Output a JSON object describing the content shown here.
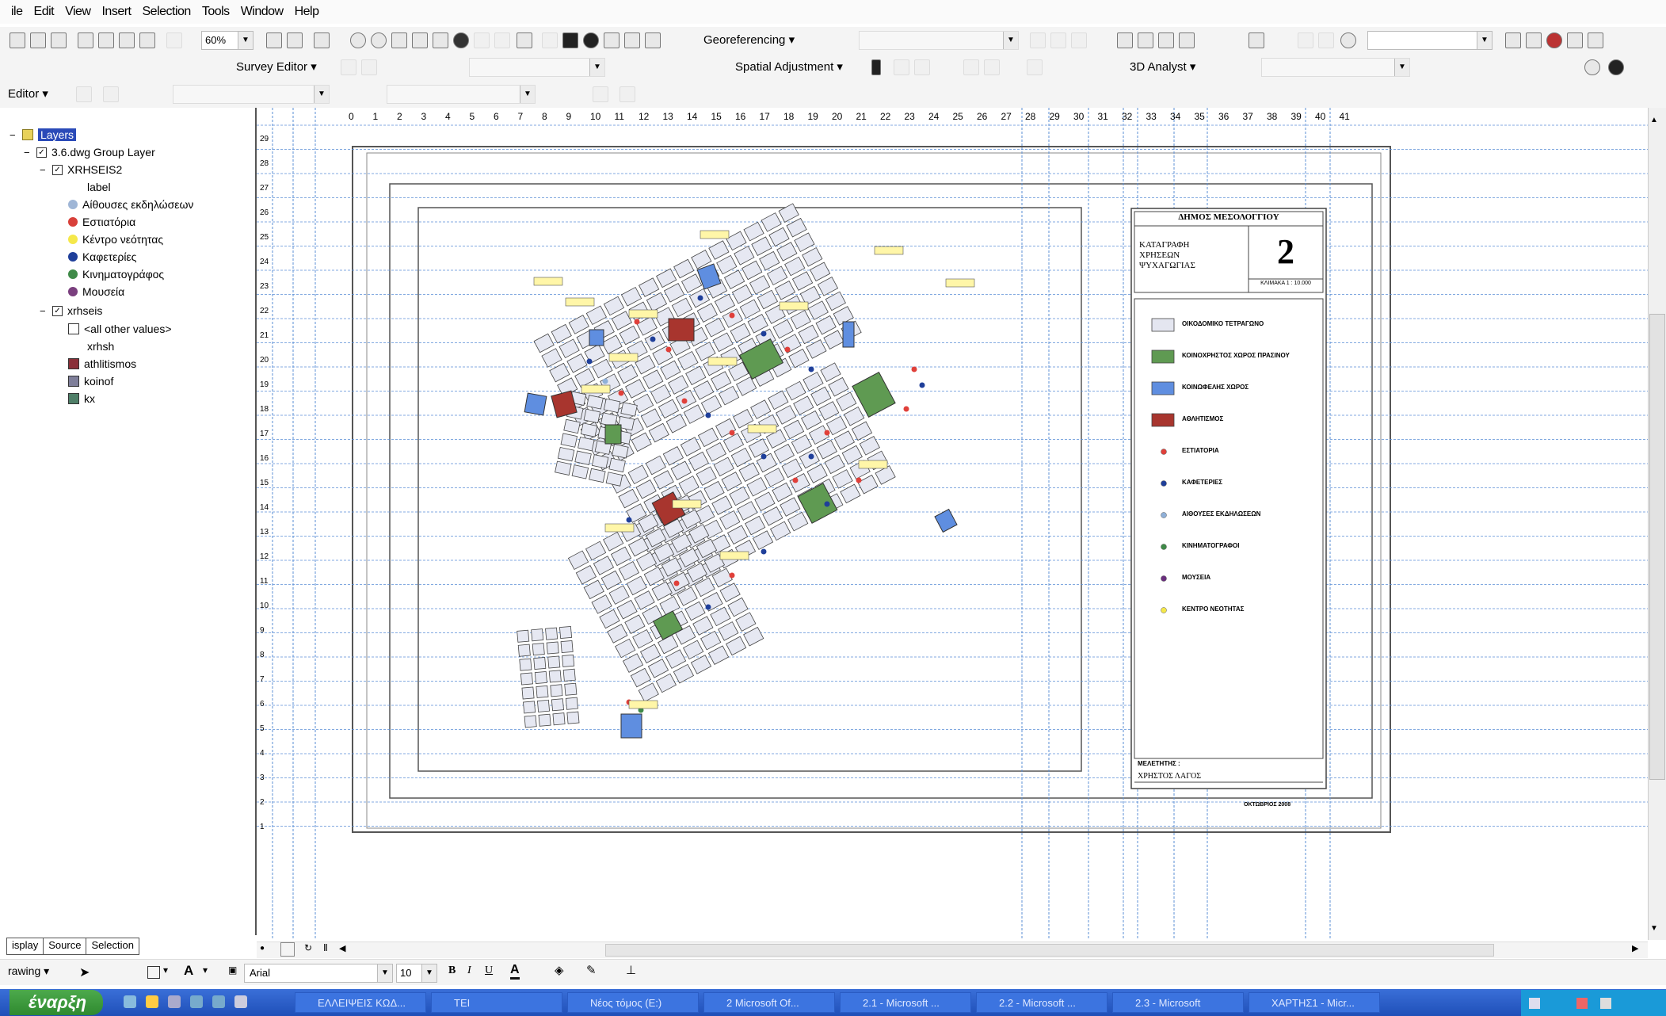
{
  "menu": [
    "ile",
    "Edit",
    "View",
    "Insert",
    "Selection",
    "Tools",
    "Window",
    "Help"
  ],
  "toolbar": {
    "zoom_value": "60%",
    "georeferencing_label": "Georeferencing",
    "survey_editor_label": "Survey Editor",
    "spatial_adjustment_label": "Spatial Adjustment",
    "analyst_label": "3D Analyst",
    "editor_label": "Editor"
  },
  "toc": {
    "root": "Layers",
    "group": "3.6.dwg Group Layer",
    "layer1": "XRHSEIS2",
    "layer1_sub": "label",
    "layer1_items": [
      {
        "label": "Αίθουσες εκδηλώσεων",
        "color": "#9fb6d6"
      },
      {
        "label": "Εστιατόρια",
        "color": "#d8403a"
      },
      {
        "label": "Κέντρο νεότητας",
        "color": "#f5e84a"
      },
      {
        "label": "Καφετερίες",
        "color": "#1f3f9a"
      },
      {
        "label": "Κινηματογράφος",
        "color": "#3f8a48"
      },
      {
        "label": "Μουσεία",
        "color": "#7a3f7e"
      }
    ],
    "layer2": "xrhseis",
    "layer2_other": "<all other values>",
    "layer2_field": "xrhsh",
    "layer2_items": [
      {
        "label": "athlitismos",
        "color": "#8a2f38"
      },
      {
        "label": "koinof",
        "color": "#7f7f9a"
      },
      {
        "label": "kx",
        "color": "#4f7f68"
      }
    ],
    "tabs": [
      "isplay",
      "Source",
      "Selection"
    ]
  },
  "ruler": [
    "0",
    "1",
    "2",
    "3",
    "4",
    "5",
    "6",
    "7",
    "8",
    "9",
    "10",
    "11",
    "12",
    "13",
    "14",
    "15",
    "16",
    "17",
    "18",
    "19",
    "20",
    "21",
    "22",
    "23",
    "24",
    "25",
    "26",
    "27",
    "28",
    "29",
    "30",
    "31",
    "32",
    "33",
    "34",
    "35",
    "36",
    "37",
    "38",
    "39",
    "40",
    "41"
  ],
  "ruler_v": [
    "29",
    "28",
    "27",
    "26",
    "25",
    "24",
    "23",
    "22",
    "21",
    "20",
    "19",
    "18",
    "17",
    "16",
    "15",
    "14",
    "13",
    "12",
    "11",
    "10",
    "9",
    "8",
    "7",
    "6",
    "5",
    "4",
    "3",
    "2",
    "1"
  ],
  "map_legend": {
    "municipality": "ΔΗΜΟΣ ΜΕΣΟΛΟΓΓΙΟΥ",
    "title_line1": "ΚΑΤΑΓΡΑΦΗ",
    "title_line2": "ΧΡΗΣΕΩΝ",
    "title_line3": "ΨΥΧΑΓΩΓΙΑΣ",
    "sheet_number": "2",
    "scale": "ΚΛΙΜΑΚΑ 1 : 10.000",
    "items": [
      {
        "label": "ΟΙΚΟΔΟΜΙΚΟ ΤΕΤΡΑΓΩΝΟ",
        "color": "#e4e6f0",
        "shape": "rect"
      },
      {
        "label": "ΚΟΙΝΟΧΡΗΣΤΟΣ ΧΩΡΟΣ ΠΡΑΣΙΝΟΥ",
        "color": "#5f9a52",
        "shape": "rect"
      },
      {
        "label": "ΚΟΙΝΩΦΕΛΗΣ ΧΩΡΟΣ",
        "color": "#5f8ee0",
        "shape": "rect"
      },
      {
        "label": "ΑΘΛΗΤΙΣΜΟΣ",
        "color": "#a8352e",
        "shape": "rect"
      },
      {
        "label": "ΕΣΤΙΑΤΟΡΙΑ",
        "color": "#e0403a",
        "shape": "dot"
      },
      {
        "label": "ΚΑΦΕΤΕΡΙΕΣ",
        "color": "#1f3f9a",
        "shape": "dot"
      },
      {
        "label": "ΑΙΘΟΥΣΕΣ ΕΚΔΗΛΩΣΕΩΝ",
        "color": "#8fb0d8",
        "shape": "dot"
      },
      {
        "label": "ΚΙΝΗΜΑΤΟΓΡΑΦΟΙ",
        "color": "#3f8a48",
        "shape": "dot"
      },
      {
        "label": "ΜΟΥΣΕΙΑ",
        "color": "#6a2f7e",
        "shape": "dot"
      },
      {
        "label": "ΚΕΝΤΡΟ ΝΕΟΤΗΤΑΣ",
        "color": "#f5e84a",
        "shape": "dot"
      }
    ],
    "author_label": "ΜΕΛΕΤΗΤΗΣ :",
    "author": "ΧΡΗΣΤΟΣ ΛΑΓΟΣ",
    "date": "ΟΚΤΩΒΡΙΟΣ 2008"
  },
  "drawing": {
    "label": "rawing",
    "font": "Arial",
    "size": "10"
  },
  "taskbar": {
    "start": "έναρξη",
    "tasks": [
      "ΕΛΛΕΙΨΕΙΣ ΚΩΔ...",
      "ΤΕΙ",
      "Νέος τόμος (E:)",
      "2 Microsoft Of...",
      "2.1 - Microsoft ...",
      "2.2 - Microsoft ...",
      "2.3 - Microsoft",
      "ΧΑΡΤΗΣ1 - Micr..."
    ]
  }
}
